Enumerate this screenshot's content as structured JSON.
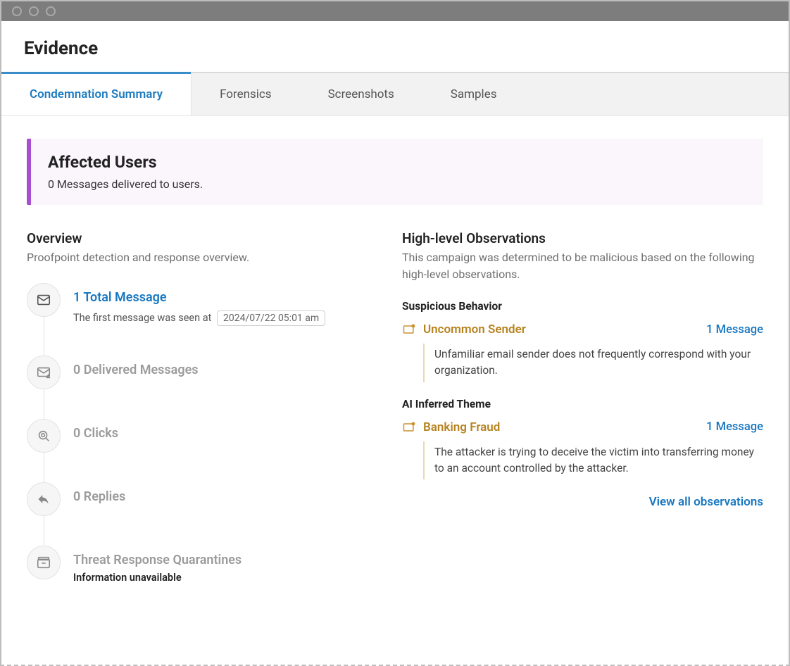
{
  "page_title": "Evidence",
  "tabs": [
    {
      "label": "Condemnation Summary",
      "active": true
    },
    {
      "label": "Forensics",
      "active": false
    },
    {
      "label": "Screenshots",
      "active": false
    },
    {
      "label": "Samples",
      "active": false
    }
  ],
  "banner": {
    "title": "Affected Users",
    "text": "0 Messages delivered to users."
  },
  "overview": {
    "title": "Overview",
    "subtitle": "Proofpoint detection and response overview.",
    "items": [
      {
        "icon": "mail",
        "title": "1 Total Message",
        "blue": true,
        "first_seen_prefix": "The first message was seen at",
        "first_seen_value": "2024/07/22 05:01 am"
      },
      {
        "icon": "mail-warn",
        "title": "0 Delivered Messages"
      },
      {
        "icon": "click",
        "title": "0 Clicks"
      },
      {
        "icon": "reply",
        "title": "0 Replies"
      },
      {
        "icon": "archive",
        "title": "Threat Response Quarantines",
        "info": "Information unavailable"
      }
    ]
  },
  "observations": {
    "title": "High-level Observations",
    "subtitle": "This campaign was determined to be malicious based on the following high-level observations.",
    "groups": [
      {
        "group": "Suspicious Behavior",
        "name": "Uncommon Sender",
        "count": "1 Message",
        "desc": "Unfamiliar email sender does not frequently correspond with your organization."
      },
      {
        "group": "AI Inferred Theme",
        "name": "Banking Fraud",
        "count": "1 Message",
        "desc": "The attacker is trying to deceive the victim into transferring money to an account controlled by the attacker."
      }
    ],
    "view_all": "View all observations"
  }
}
